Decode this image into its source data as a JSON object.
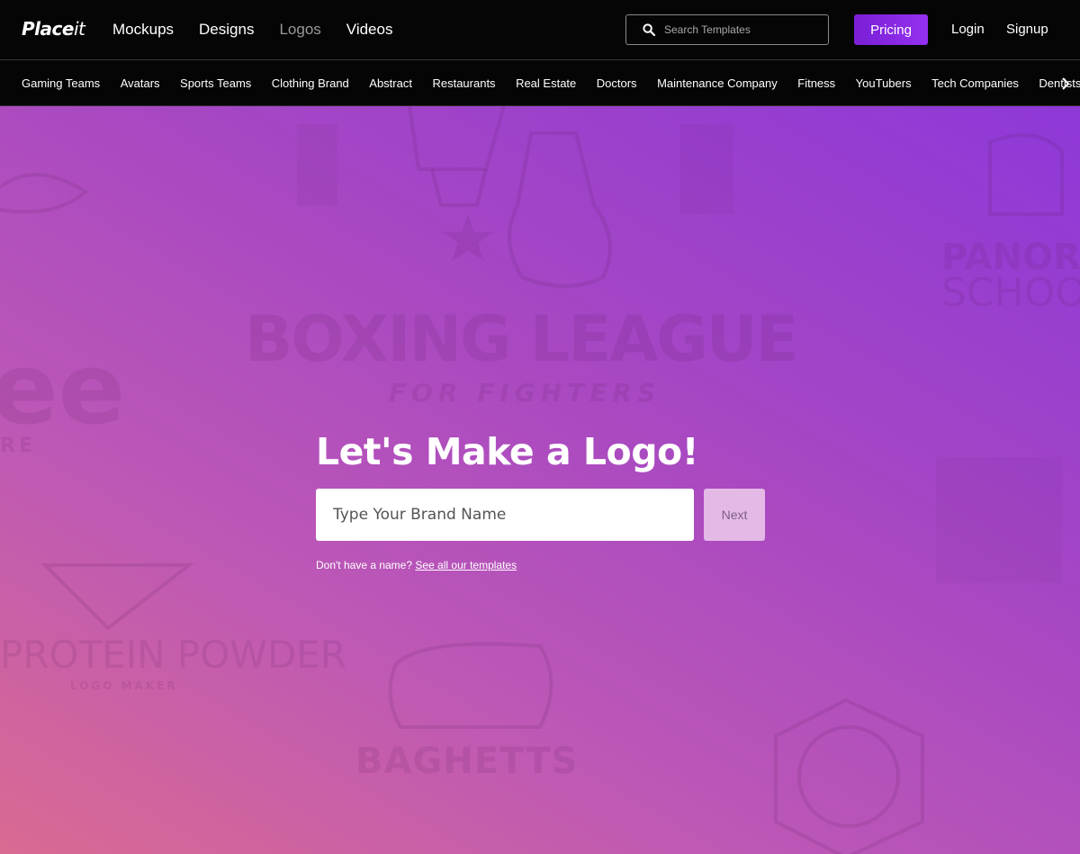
{
  "brand": {
    "name_bold": "Place",
    "name_light": "it"
  },
  "nav": {
    "items": [
      {
        "label": "Mockups"
      },
      {
        "label": "Designs"
      },
      {
        "label": "Logos"
      },
      {
        "label": "Videos"
      }
    ],
    "active": "Logos"
  },
  "search": {
    "placeholder": "Search Templates"
  },
  "header_actions": {
    "pricing": "Pricing",
    "login": "Login",
    "signup": "Signup"
  },
  "categories": [
    "Gaming Teams",
    "Avatars",
    "Sports Teams",
    "Clothing Brand",
    "Abstract",
    "Restaurants",
    "Real Estate",
    "Doctors",
    "Maintenance Company",
    "Fitness",
    "YouTubers",
    "Tech Companies",
    "Dentists"
  ],
  "hero": {
    "title": "Let's Make a Logo!",
    "input_placeholder": "Type Your Brand Name",
    "next_label": "Next",
    "helper_text": "Don't have a name?",
    "helper_link": "See all our templates"
  },
  "background_logos": {
    "boxing_title": "BOXING LEAGUE",
    "boxing_subtitle": "FOR FIGHTERS",
    "protein_title": "PROTEIN POWDER",
    "protein_subtitle": "LOGO MAKER",
    "school_line1": "PANORAMA",
    "school_line2": "SCHOOL",
    "left_fragment": "ee",
    "left_fragment_sub": "RE",
    "bottom_fragment": "BAGHETTS"
  },
  "colors": {
    "accent": "#8a2be2",
    "hero_gradient_start": "#d96a92",
    "hero_gradient_end": "#8e38d8",
    "next_button": "#e4b9e6"
  },
  "icons": [
    "search-icon",
    "chevron-right-icon"
  ]
}
